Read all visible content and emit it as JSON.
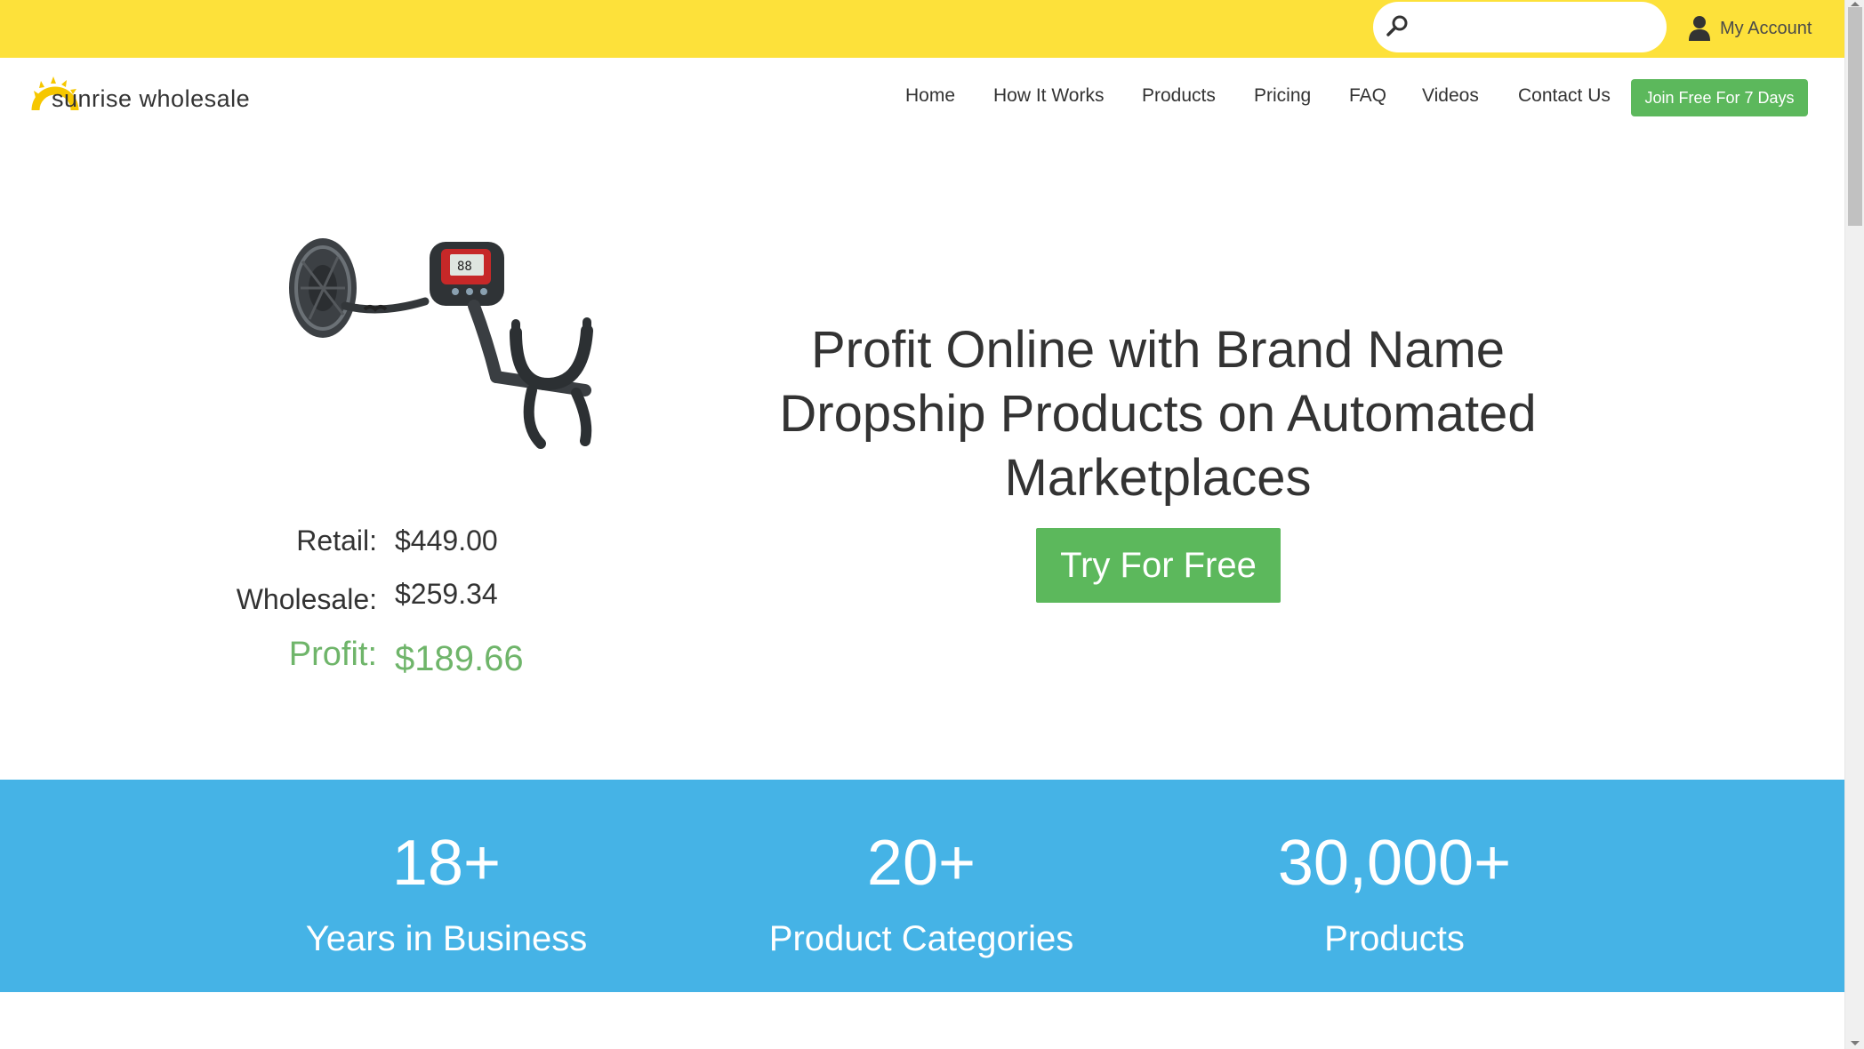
{
  "topbar": {
    "search": {
      "placeholder": ""
    },
    "account_label": "My Account"
  },
  "header": {
    "logo_text": "sunrise wholesale",
    "nav": [
      {
        "label": "Home"
      },
      {
        "label": "How It Works"
      },
      {
        "label": "Products"
      },
      {
        "label": "Pricing"
      },
      {
        "label": "FAQ"
      },
      {
        "label": "Videos"
      },
      {
        "label": "Contact Us"
      }
    ],
    "cta_label": "Join Free For 7 Days"
  },
  "hero": {
    "product_icon": "metal-detector",
    "pricing": {
      "retail_label": "Retail:",
      "retail_value": "$449.00",
      "wholesale_label": "Wholesale:",
      "wholesale_value": "$259.34",
      "profit_label": "Profit:",
      "profit_value": "$189.66"
    },
    "heading_lines": [
      "Profit Online with Brand Name",
      "Dropship Products on Automated",
      "Marketplaces"
    ],
    "cta_label": "Try For Free"
  },
  "stats": [
    {
      "number": "18+",
      "label": "Years in Business"
    },
    {
      "number": "20+",
      "label": "Product Categories"
    },
    {
      "number": "30,000+",
      "label": "Products"
    }
  ],
  "colors": {
    "topbar": "#fde13a",
    "accent_green": "#5cb85c",
    "profit_green": "#6fb56a",
    "stats_blue": "#45b3e6"
  }
}
